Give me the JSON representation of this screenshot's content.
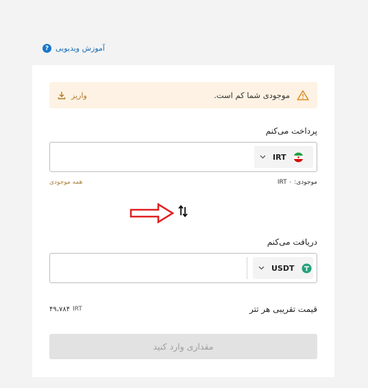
{
  "video_tutorial": {
    "label": "آموزش ویدیویی",
    "icon": "help-circle-icon"
  },
  "alert": {
    "message": "موجودی شما کم است.",
    "deposit_label": "واریز",
    "color": "#fdf2e3"
  },
  "pay": {
    "label": "پرداخت می‌کنم",
    "currency": "IRT",
    "amount": "",
    "balance_text": "موجودی: IRT ۰",
    "all_balance_label": "همه موجودی"
  },
  "receive": {
    "label": "دریافت می‌کنم",
    "currency": "USDT",
    "amount": ""
  },
  "price": {
    "label": "قیمت تقریبی هر تتر",
    "value": "۴۹،۷۸۴",
    "unit": "IRT"
  },
  "submit": {
    "label": "مقداری وارد کنید"
  },
  "colors": {
    "accent": "#1877c9",
    "annotation_arrow": "#e02020",
    "tether": "#26a17b"
  }
}
